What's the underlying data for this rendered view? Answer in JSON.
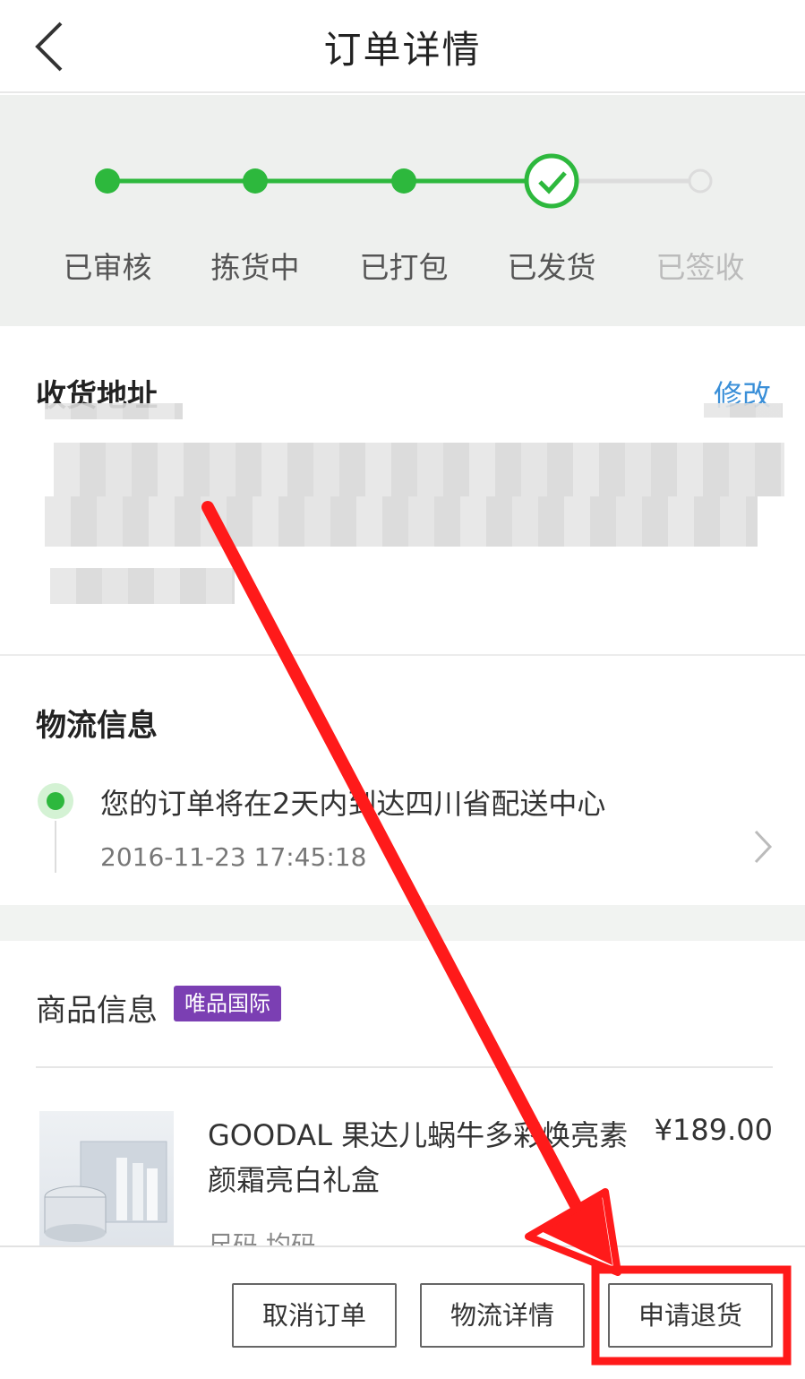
{
  "header": {
    "title": "订单详情"
  },
  "progress": {
    "steps": [
      {
        "label": "已审核",
        "state": "done"
      },
      {
        "label": "拣货中",
        "state": "done"
      },
      {
        "label": "已打包",
        "state": "done"
      },
      {
        "label": "已发货",
        "state": "current"
      },
      {
        "label": "已签收",
        "state": "pending"
      }
    ],
    "colors": {
      "active": "#2db83d",
      "pending": "#dcdcdc"
    }
  },
  "address": {
    "title": "收货地址",
    "edit_label": "修改"
  },
  "logistics": {
    "title": "物流信息",
    "message": "您的订单将在2天内到达四川省配送中心",
    "time": "2016-11-23 17:45:18"
  },
  "product": {
    "section_title": "商品信息",
    "badge": "唯品国际",
    "name": "GOODAL 果达儿蜗牛多彩焕亮素颜霜亮白礼盒",
    "price": "¥189.00",
    "size": "尺码 均码"
  },
  "footer": {
    "cancel_label": "取消订单",
    "logistics_label": "物流详情",
    "return_label": "申请退货"
  },
  "annotation": {
    "color": "#ff1a1a"
  }
}
